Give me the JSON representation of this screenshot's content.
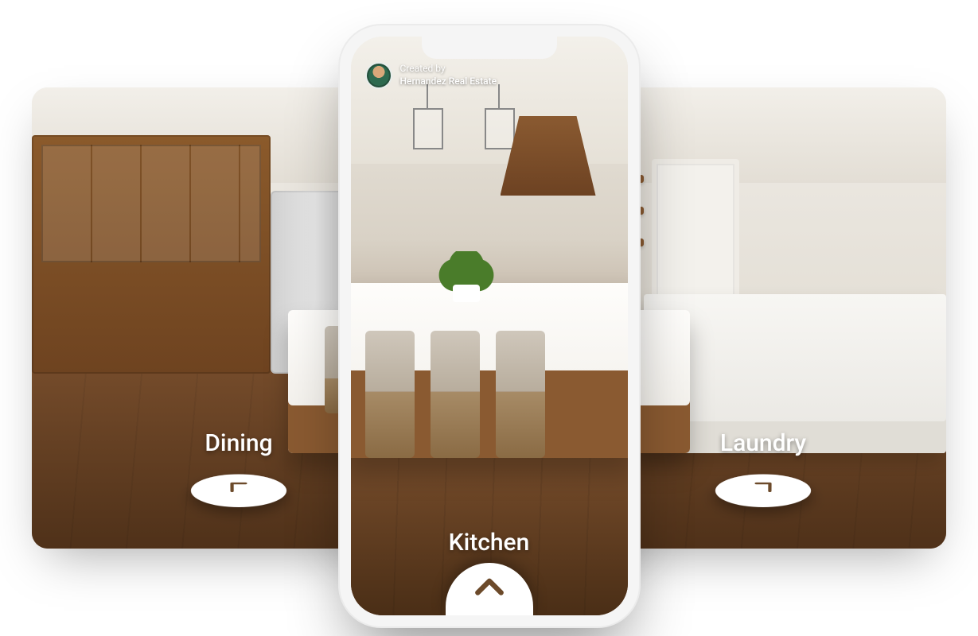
{
  "creator": {
    "prefix": "Created by",
    "name": "Hernandez Real Estate"
  },
  "rooms": {
    "left": {
      "label": "Dining",
      "icon": "arrow-left-icon"
    },
    "center": {
      "label": "Kitchen",
      "icon": "chevron-up-icon"
    },
    "right": {
      "label": "Laundry",
      "icon": "arrow-right-icon"
    }
  },
  "colors": {
    "arrow": "#6c4a2a"
  }
}
